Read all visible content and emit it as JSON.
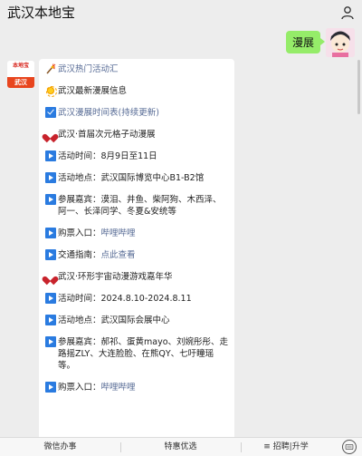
{
  "header": {
    "title": "武汉本地宝",
    "profile_icon": "person-icon"
  },
  "user_message": "漫展",
  "bot": {
    "avatar_top": "本地宝",
    "avatar_bottom": "武汉"
  },
  "content": [
    {
      "icon": "firework-icon",
      "text": "武汉热门活动汇",
      "style": "blue"
    },
    {
      "icon": "sun-icon",
      "text": "武汉最新漫展信息",
      "style": "normal"
    },
    {
      "icon": "check-icon",
      "text": "武汉漫展时间表(持续更新)",
      "style": "link"
    },
    {
      "icon": "heart-icon",
      "text": "武汉·首届次元格子动漫展",
      "style": "normal"
    },
    {
      "icon": "play-icon",
      "text": "活动时间：8月9日至11日",
      "style": "normal"
    },
    {
      "icon": "play-icon",
      "text": "活动地点：武汉国际博览中心B1-B2馆",
      "style": "normal"
    },
    {
      "icon": "play-icon",
      "text": "参展嘉宾：漠泪、井鱼、柴阿狗、木西泽、阿一、长泽同学、冬夏&安统等",
      "style": "normal"
    },
    {
      "icon": "play-icon",
      "text": "购票入口：",
      "link": "哔哩哔哩",
      "style": "mixed"
    },
    {
      "icon": "play-icon",
      "text": "交通指南：",
      "link": "点此查看",
      "style": "mixed"
    },
    {
      "icon": "heart-icon",
      "text": "武汉·环形宇宙动漫游戏嘉年华",
      "style": "normal"
    },
    {
      "icon": "play-icon",
      "text": "活动时间：2024.8.10-2024.8.11",
      "style": "normal"
    },
    {
      "icon": "play-icon",
      "text": "活动地点：武汉国际会展中心",
      "style": "normal"
    },
    {
      "icon": "play-icon",
      "text": "参展嘉宾：郝祁、蛋黄mayo、刘婉彤彤、走路摇ZLY、大连脸脸、在熊QY、七吁瞳瑶等。",
      "style": "normal"
    },
    {
      "icon": "play-icon",
      "text": "购票入口：",
      "link": "哔哩哔哩",
      "style": "mixed"
    }
  ],
  "bottom_tabs": [
    {
      "label": "微信办事"
    },
    {
      "label": "特惠优选"
    },
    {
      "label": "≡ 招聘|升学"
    }
  ],
  "colors": {
    "user_bubble": "#95ec69",
    "link": "#576b95",
    "background": "#ededed"
  }
}
